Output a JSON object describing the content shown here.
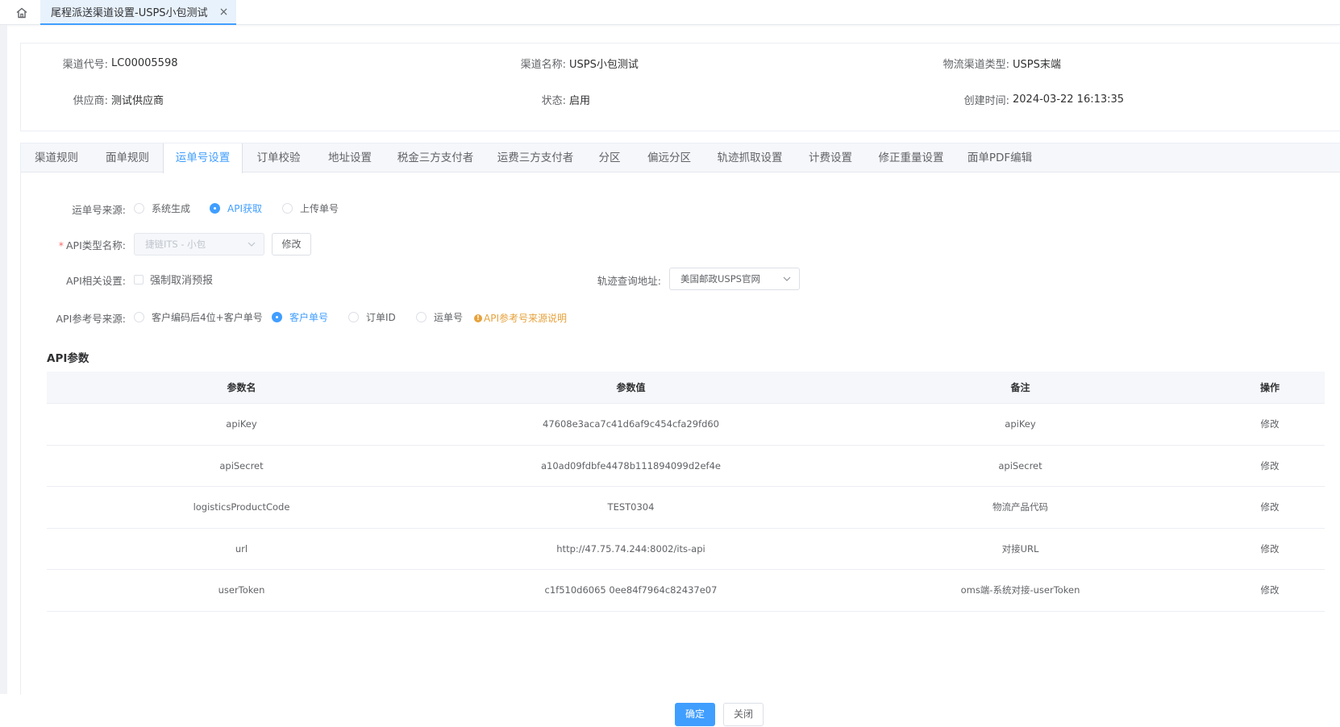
{
  "top_tab": {
    "title": "尾程派送渠道设置-USPS小包测试",
    "close": "×"
  },
  "info": {
    "channel_code_label": "渠道代号:",
    "channel_code": "LC00005598",
    "channel_name_label": "渠道名称:",
    "channel_name": "USPS小包测试",
    "logistics_type_label": "物流渠道类型:",
    "logistics_type": "USPS末端",
    "supplier_label": "供应商:",
    "supplier": "测试供应商",
    "status_label": "状态:",
    "status": "启用",
    "created_label": "创建时间:",
    "created": "2024-03-22 16:13:35"
  },
  "tabs": [
    {
      "label": "渠道规则"
    },
    {
      "label": "面单规则"
    },
    {
      "label": "运单号设置"
    },
    {
      "label": "订单校验"
    },
    {
      "label": "地址设置"
    },
    {
      "label": "税金三方支付者"
    },
    {
      "label": "运费三方支付者"
    },
    {
      "label": "分区"
    },
    {
      "label": "偏远分区"
    },
    {
      "label": "轨迹抓取设置"
    },
    {
      "label": "计费设置"
    },
    {
      "label": "修正重量设置"
    },
    {
      "label": "面单PDF编辑"
    }
  ],
  "active_tab": "运单号设置",
  "form": {
    "waybill_source_label": "运单号来源:",
    "waybill_source_options": [
      {
        "label": "系统生成"
      },
      {
        "label": "API获取"
      },
      {
        "label": "上传单号"
      }
    ],
    "waybill_source_selected": "API获取",
    "api_type_label": "API类型名称:",
    "api_type_required": "*",
    "api_type_value": "捷链ITS - 小包",
    "edit_button": "修改",
    "api_settings_label": "API相关设置:",
    "force_cancel_label": "强制取消预报",
    "track_url_label": "轨迹查询地址:",
    "track_url_value": "美国邮政USPS官网",
    "api_ref_label": "API参考号来源:",
    "api_ref_options": [
      {
        "label": "客户编码后4位+客户单号"
      },
      {
        "label": "客户单号"
      },
      {
        "label": "订单ID"
      },
      {
        "label": "运单号"
      }
    ],
    "api_ref_selected": "客户单号",
    "api_ref_hint_icon": "!",
    "api_ref_hint": "API参考号来源说明"
  },
  "params": {
    "title": "API参数",
    "headers": [
      "参数名",
      "参数值",
      "备注",
      "操作"
    ],
    "rows": [
      {
        "name": "apiKey",
        "value": "47608e3aca7c41d6af9c454cfa29fd60",
        "note": "apiKey",
        "op": "修改"
      },
      {
        "name": "apiSecret",
        "value": "a10ad09fdbfe4478b111894099d2ef4e",
        "note": "apiSecret",
        "op": "修改"
      },
      {
        "name": "logisticsProductCode",
        "value": "TEST0304",
        "note": "物流产品代码",
        "op": "修改"
      },
      {
        "name": "url",
        "value": "http://47.75.74.244:8002/its-api",
        "note": "对接URL",
        "op": "修改"
      },
      {
        "name": "userToken",
        "value": "c1f510d6065     0ee84f7964c82437e07",
        "note": "oms端-系统对接-userToken",
        "op": "修改"
      }
    ]
  },
  "footer": {
    "confirm": "确定",
    "close": "关闭"
  },
  "colors": {
    "primary": "#409eff",
    "warning": "#e6a23c",
    "danger": "#f56c6c"
  }
}
